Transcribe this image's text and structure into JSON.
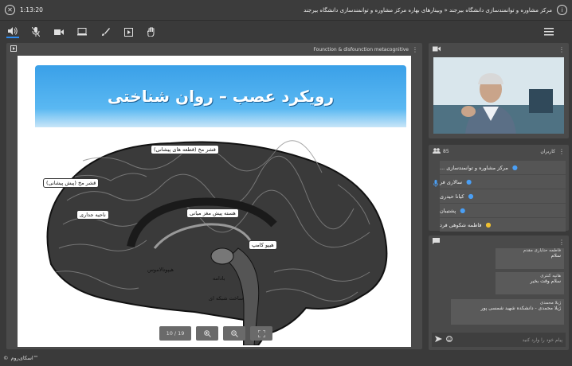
{
  "header": {
    "timer": "1:13:20",
    "title": "مرکز مشاوره و توانمندسازی دانشگاه بیرجند « وبینارهای بهاره مرکز مشاوره و توانمندسازی دانشگاه بیرجند"
  },
  "slide_panel": {
    "title": "Founction & disfounction metacognitive",
    "slide_title": "رویکرد عصب – روان شناختی",
    "page": "10 / 19"
  },
  "brain_labels": {
    "l1": "قشر مخ (قطعه های پیشانی)",
    "l2": "قشر مخ (پیش پیشانی)",
    "l3": "ناحیه جداری",
    "l4": "هسته پیش مغز میانی",
    "l5": "هیپو کامپ",
    "l6": "هیپوتالاموس",
    "l7": "بادامه",
    "l8": "ساخت شبکه ای"
  },
  "users_panel": {
    "title": "کاربران",
    "count": "85",
    "users": [
      "مرکز مشاوره و توانمندسازی ...",
      "سالاری فر",
      "کیانا حیدری",
      "پشتیبان",
      "فاطمه شکوهی فرد"
    ]
  },
  "chat": {
    "messages": [
      {
        "name": "فاطمه حنایاری مقدم",
        "text": "سلام"
      },
      {
        "name": "هانیه کنتری",
        "text": "سلام وقت بخیر"
      },
      {
        "name": "ژیلا محمدی",
        "text": "ژیلا محمدی - دانشکده شهید شمسی پور"
      }
    ],
    "placeholder": "پیام خود را وارد کنید"
  },
  "footer": {
    "brand": "اسکای‌روم™"
  },
  "colors": {
    "accent": "#2d8cf0",
    "panel": "#4a4a4a",
    "background": "#3a3a3a",
    "slide_band": "#3aa0e8"
  }
}
